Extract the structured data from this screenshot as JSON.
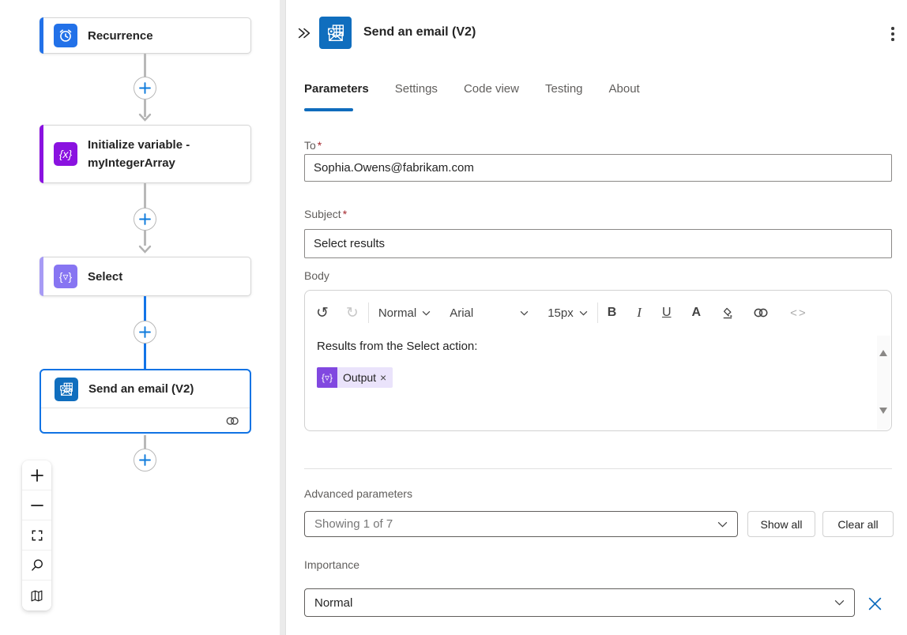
{
  "colors": {
    "primary_blue": "#0f6cbd",
    "selected_blue": "#1374e8",
    "plus_blue": "#0f7bdc",
    "connector_gray": "#b9b9b9",
    "recurrence_blue": "#2271e8",
    "variable_purple": "#8a12e0",
    "select_purple": "#8775f2",
    "select_accent": "#a79bf5",
    "token_purple": "#8148e0",
    "token_bg": "#eae3fb",
    "outlook_blue": "#106ebe",
    "required_red": "#a4262c",
    "label_gray": "#605e5c"
  },
  "canvas": {
    "nodes": {
      "recurrence": {
        "label": "Recurrence"
      },
      "initialize_variable": {
        "label_line1": "Initialize variable -",
        "label_line2": "myIntegerArray"
      },
      "select": {
        "label": "Select"
      },
      "send_email": {
        "label": "Send an email (V2)"
      }
    },
    "icons": {
      "braces_x": "{x}",
      "braces_select": "{▿}"
    }
  },
  "panel": {
    "header": {
      "title": "Send an email (V2)"
    },
    "tabs": {
      "parameters": "Parameters",
      "settings": "Settings",
      "code_view": "Code view",
      "testing": "Testing",
      "about": "About"
    },
    "to": {
      "label": "To",
      "required": "*",
      "value": "Sophia.Owens@fabrikam.com"
    },
    "subject": {
      "label": "Subject",
      "required": "*",
      "value": "Select results"
    },
    "body": {
      "label": "Body",
      "toolbar": {
        "text_style": "Normal",
        "font": "Arial",
        "size": "15px",
        "bold": "B",
        "italic": "I",
        "underline": "U",
        "font_color": "A",
        "code": "<>"
      },
      "content": "Results from the Select action:",
      "token": {
        "label": "Output",
        "remove": "×"
      }
    },
    "advanced": {
      "label": "Advanced parameters",
      "value": "Showing 1 of 7",
      "show_all": "Show all",
      "clear_all": "Clear all"
    },
    "importance": {
      "label": "Importance",
      "value": "Normal"
    }
  }
}
